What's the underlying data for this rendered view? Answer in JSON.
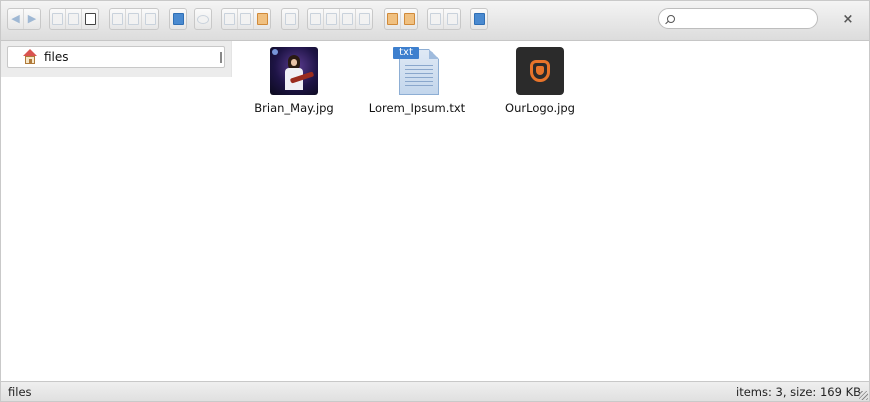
{
  "toolbar": {
    "groups": [
      {
        "name": "history",
        "buttons": [
          "back-icon",
          "forward-icon"
        ]
      },
      {
        "name": "file",
        "buttons": [
          "open-icon",
          "mkdir-icon",
          "save-icon"
        ]
      },
      {
        "name": "clipboard",
        "buttons": [
          "copy-icon",
          "cut-icon",
          "paste-icon"
        ]
      },
      {
        "name": "info",
        "buttons": [
          "info-icon"
        ]
      },
      {
        "name": "preview",
        "buttons": [
          "eye-icon"
        ]
      },
      {
        "name": "edit",
        "buttons": [
          "duplicate-icon",
          "rename-icon",
          "edit-icon"
        ]
      },
      {
        "name": "extract",
        "buttons": [
          "extract-icon"
        ]
      },
      {
        "name": "archive",
        "buttons": [
          "archive-icon",
          "crop-icon",
          "resize-icon",
          "rotate-icon"
        ]
      },
      {
        "name": "upload",
        "buttons": [
          "upload-icon",
          "download-icon"
        ]
      },
      {
        "name": "view",
        "buttons": [
          "icons-view-icon",
          "list-view-icon"
        ]
      },
      {
        "name": "help",
        "buttons": [
          "help-icon"
        ]
      }
    ]
  },
  "search": {
    "placeholder": "",
    "value": ""
  },
  "tree": {
    "root_label": "files",
    "root_icon": "home-icon"
  },
  "files": [
    {
      "name": "Brian_May.jpg",
      "kind": "image",
      "icon": "photo-thumbnail"
    },
    {
      "name": "Lorem_Ipsum.txt",
      "kind": "text",
      "icon": "text-file-icon",
      "badge": "txt"
    },
    {
      "name": "OurLogo.jpg",
      "kind": "image",
      "icon": "logo-thumbnail"
    }
  ],
  "status": {
    "path": "files",
    "summary": "items: 3, size: 169 KB"
  },
  "colors": {
    "accent": "#3d7fce",
    "logo": "#e8742a"
  }
}
